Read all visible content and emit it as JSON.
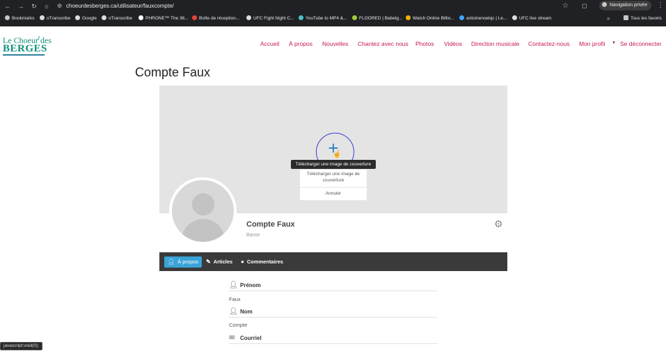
{
  "browser": {
    "url": "choeurdesberges.ca/utilisateur/fauxcompte/",
    "private_label": "Navigation privée",
    "bookmarks": [
      {
        "label": "Bookmarks",
        "color": "#c4c7c5"
      },
      {
        "label": "oTranscribe",
        "color": "#dddddd"
      },
      {
        "label": "Google",
        "color": "#dddddd"
      },
      {
        "label": "oTranscribe",
        "color": "#dddddd"
      },
      {
        "label": "PHRONE™ The 36...",
        "color": "#ffffff"
      },
      {
        "label": "Boîte de réception...",
        "color": "#ea4335"
      },
      {
        "label": "UFC Fight Night C...",
        "color": "#dddddd"
      },
      {
        "label": "YouTube to MP4 &...",
        "color": "#4cc2c4"
      },
      {
        "label": "FLOORED | Babelg...",
        "color": "#a3c93a"
      },
      {
        "label": "Watch Online Billio...",
        "color": "#f4b400"
      },
      {
        "label": "antoinenoelqc | Le...",
        "color": "#3ea6ff"
      },
      {
        "label": "UFC live stream",
        "color": "#dddddd"
      }
    ],
    "all_bookmarks_label": "Tous les favoris",
    "status_url": "javascript:void(0);"
  },
  "site": {
    "logo_top": "Le Choeur des",
    "logo_bottom": "BERGES",
    "nav": [
      "Accueil",
      "À propos",
      "Nouvelles",
      "Chantez avec nous",
      "Photos",
      "Vidéos",
      "Direction musicale",
      "Contactez-nous",
      "Mon profil",
      "Se déconnecter"
    ],
    "accent_color": "#c8174d",
    "brand_color": "#0f8f7a"
  },
  "page": {
    "title": "Compte Faux"
  },
  "cover": {
    "tooltip": "Télécharger une image de couverture",
    "menu_upload": "Télécharger une image de couverture",
    "menu_cancel": "Annuler"
  },
  "profile": {
    "name": "Compte Faux",
    "role": "Basse"
  },
  "tabs": [
    {
      "label": "À propos",
      "icon": "user-icon",
      "active": true
    },
    {
      "label": "Articles",
      "icon": "pencil-icon",
      "active": false
    },
    {
      "label": "Commentaires",
      "icon": "comment-icon",
      "active": false
    }
  ],
  "about": {
    "fields": [
      {
        "label": "Prénom",
        "value": "Faux",
        "icon": "user-icon"
      },
      {
        "label": "Nom",
        "value": "Compte",
        "icon": "user-icon"
      },
      {
        "label": "Courriel",
        "value": "",
        "icon": "envelope-icon"
      }
    ]
  }
}
